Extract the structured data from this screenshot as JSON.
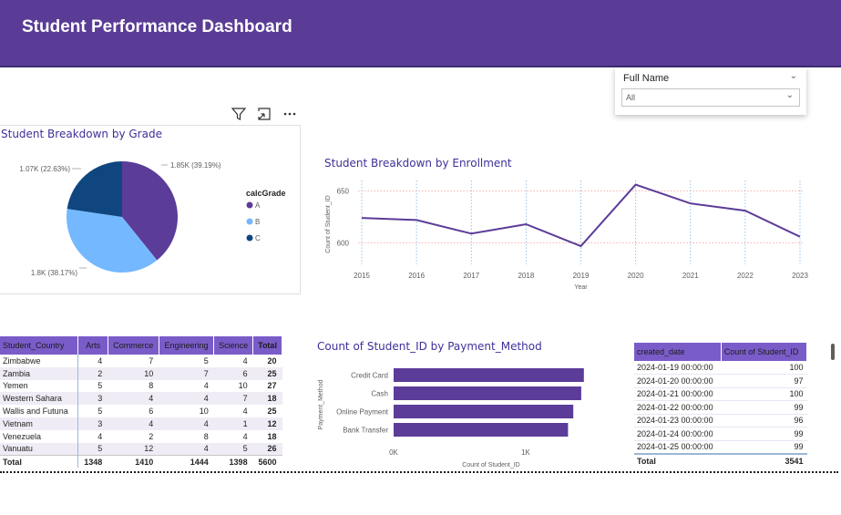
{
  "header": {
    "title": "Student Performance Dashboard"
  },
  "slicer": {
    "title": "Full Name",
    "value": "All"
  },
  "pie": {
    "title": "Student Breakdown by Grade",
    "legend_title": "calcGrade",
    "labels": [
      "1.85K (39.19%)",
      "1.8K (38.17%)",
      "1.07K (22.63%)"
    ]
  },
  "line": {
    "title": "Student Breakdown by Enrollment",
    "xlabel": "Year",
    "ylabel": "Count of Student_ID"
  },
  "bar": {
    "title": "Count of Student_ID by Payment_Method",
    "xlabel": "Count of Student_ID",
    "ylabel": "Payment_Method",
    "ticks": [
      "0K",
      "1K"
    ]
  },
  "chart_data": [
    {
      "type": "pie",
      "title": "Student Breakdown by Grade",
      "legend_title": "calcGrade",
      "categories": [
        "A",
        "B",
        "C"
      ],
      "values": [
        1850,
        1800,
        1070
      ],
      "percent": [
        39.19,
        38.17,
        22.63
      ],
      "colors": [
        "#5b3c98",
        "#74b8ff",
        "#10467f"
      ]
    },
    {
      "type": "line",
      "title": "Student Breakdown by Enrollment",
      "xlabel": "Year",
      "ylabel": "Count of Student_ID",
      "x": [
        "2015",
        "2016",
        "2017",
        "2018",
        "2019",
        "2020",
        "2021",
        "2022",
        "2023"
      ],
      "values": [
        624,
        622,
        609,
        618,
        597,
        656,
        638,
        631,
        606
      ],
      "yticks": [
        "600",
        "650"
      ],
      "ylim": [
        590,
        660
      ],
      "color": "#5b3c98"
    },
    {
      "type": "bar",
      "orientation": "horizontal",
      "title": "Count of Student_ID by Payment_Method",
      "xlabel": "Count of Student_ID",
      "ylabel": "Payment_Method",
      "categories": [
        "Credit Card",
        "Cash",
        "Online Payment",
        "Bank Transfer"
      ],
      "values": [
        1440,
        1420,
        1360,
        1320
      ],
      "xticks": [
        "0K",
        "1K"
      ],
      "xlim": [
        0,
        1600
      ],
      "color": "#5b3c98"
    }
  ],
  "grade_table": {
    "headers": [
      "Student_Country",
      "Arts",
      "Commerce",
      "Engineering",
      "Science",
      "Total"
    ],
    "rows": [
      [
        "Zimbabwe",
        "4",
        "7",
        "5",
        "4",
        "20"
      ],
      [
        "Zambia",
        "2",
        "10",
        "7",
        "6",
        "25"
      ],
      [
        "Yemen",
        "5",
        "8",
        "4",
        "10",
        "27"
      ],
      [
        "Western Sahara",
        "3",
        "4",
        "4",
        "7",
        "18"
      ],
      [
        "Wallis and Futuna",
        "5",
        "6",
        "10",
        "4",
        "25"
      ],
      [
        "Vietnam",
        "3",
        "4",
        "4",
        "1",
        "12"
      ],
      [
        "Venezuela",
        "4",
        "2",
        "8",
        "4",
        "18"
      ],
      [
        "Vanuatu",
        "5",
        "12",
        "4",
        "5",
        "26"
      ]
    ],
    "total": [
      "Total",
      "1348",
      "1410",
      "1444",
      "1398",
      "5600"
    ]
  },
  "date_table": {
    "headers": [
      "created_date",
      "Count of Student_ID"
    ],
    "rows": [
      [
        "2024-01-19 00:00:00",
        "100"
      ],
      [
        "2024-01-20 00:00:00",
        "97"
      ],
      [
        "2024-01-21 00:00:00",
        "100"
      ],
      [
        "2024-01-22 00:00:00",
        "99"
      ],
      [
        "2024-01-23 00:00:00",
        "96"
      ],
      [
        "2024-01-24 00:00:00",
        "99"
      ],
      [
        "2024-01-25 00:00:00",
        "99"
      ]
    ],
    "total": [
      "Total",
      "3541"
    ]
  }
}
